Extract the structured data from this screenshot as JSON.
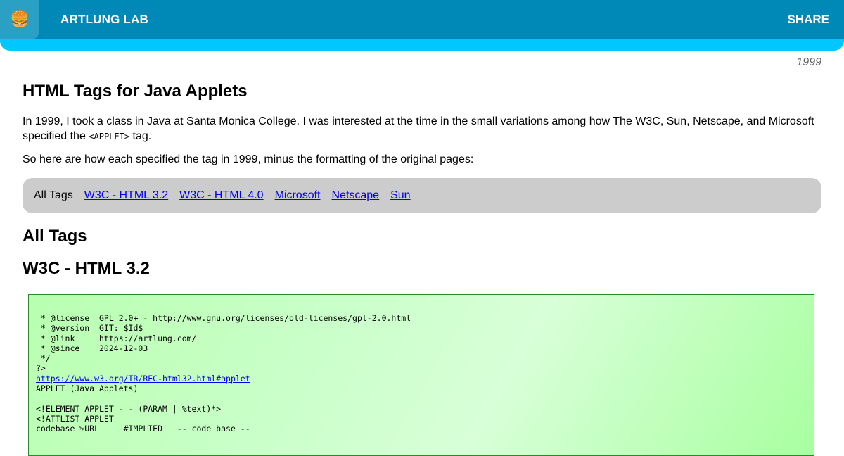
{
  "header": {
    "logo_emoji": "🍔",
    "site_title": "ARTLUNG LAB",
    "share_label": "SHARE",
    "colors": {
      "bar": "#0088b6",
      "accent": "#00c8ff"
    }
  },
  "article": {
    "year": "1999",
    "title": "HTML Tags for Java Applets",
    "intro_before": "In 1999, I took a class in Java at Santa Monica College. I was interested at the time in the small variations among how The W3C, Sun, Netscape, and Microsoft specified the ",
    "intro_code": "<APPLET>",
    "intro_after": " tag.",
    "para2": "So here are how each specified the tag in 1999, minus the formatting of the original pages:"
  },
  "tabs": [
    {
      "label": "All Tags",
      "active": true
    },
    {
      "label": "W3C - HTML 3.2",
      "active": false
    },
    {
      "label": "W3C - HTML 4.0",
      "active": false
    },
    {
      "label": "Microsoft",
      "active": false
    },
    {
      "label": "Netscape",
      "active": false
    },
    {
      "label": "Sun",
      "active": false
    }
  ],
  "sections": {
    "all_tags_heading": "All Tags",
    "w3c32_heading": "W3C - HTML 3.2"
  },
  "code": {
    "header_lines": " * @license  GPL 2.0+ - http://www.gnu.org/licenses/old-licenses/gpl-2.0.html\n * @version  GIT: $Id$\n * @link     https://artlung.com/\n * @since    2024-12-03\n */\n?>",
    "link": "https://www.w3.org/TR/REC-html32.html#applet",
    "body_lines": "\nAPPLET (Java Applets)\n\n<!ELEMENT APPLET - - (PARAM | %text)*>\n<!ATTLIST APPLET\ncodebase %URL     #IMPLIED   -- code base --"
  }
}
